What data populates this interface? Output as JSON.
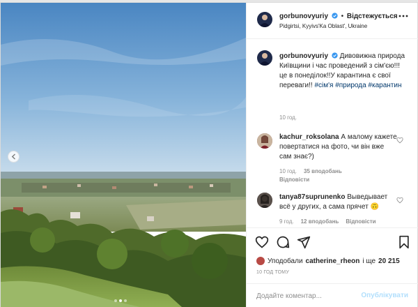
{
  "post": {
    "header": {
      "username": "gorbunovyuriy",
      "follow_status": "Відстежується",
      "location": "Pidgirtsi, Kyyivs'Ka Oblast', Ukraine"
    },
    "caption": {
      "username": "gorbunovyuriy",
      "text": "Дивовижна природа Київщини і час проведений з сім'єю!!! це в понеділок!!У карантина є свої переваги!!",
      "tags": [
        "#сім'я",
        "#природа",
        "#карантин"
      ],
      "time": "10 год."
    },
    "comments": [
      {
        "username": "kachur_roksolana",
        "text": "А малому кажете повертатися на фото, чи він вже сам знає?)",
        "time": "10 год.",
        "likes": "35 вподобань",
        "reply": "Відповісти"
      },
      {
        "username": "tanya87suprunenko",
        "text": "Выведывает всё у других, а сама прячет",
        "emoji": "🙃",
        "time": "9 год.",
        "likes": "12 вподобань",
        "reply": "Відповісти"
      }
    ],
    "likes_summary": {
      "prefix": "Уподобали",
      "user": "catherine_rheon",
      "suffix": "і ще",
      "count": "20 215"
    },
    "posted_ago": "10 ГОД ТОМУ",
    "add_comment": {
      "placeholder": "Додайте коментар...",
      "publish_label": "Опублікувати"
    }
  },
  "icons": {
    "verified": "verified-badge-icon",
    "more": "more-options-icon",
    "like": "heart-icon",
    "comment": "comment-icon",
    "share": "send-icon",
    "save": "bookmark-icon",
    "prev": "chevron-left-icon"
  },
  "colors": {
    "link": "#00376b",
    "verified": "#3897f0",
    "muted": "#8e8e8e",
    "publish_disabled": "#b2dffc"
  },
  "carousel": {
    "total": 3,
    "active": 2
  }
}
